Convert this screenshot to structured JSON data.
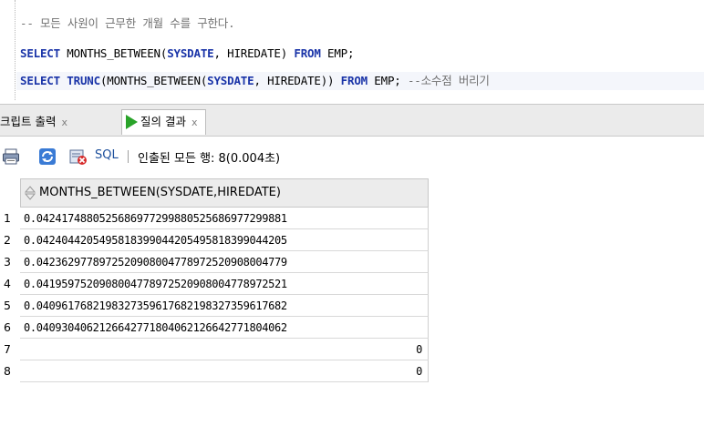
{
  "editor": {
    "lines": [
      {
        "segments": [
          {
            "t": "cm",
            "text": "-- 모든 사원이 근무한 개월 수를 구한다."
          }
        ]
      },
      {
        "segments": [
          {
            "t": "kw",
            "text": "SELECT"
          },
          {
            "t": "tx",
            "text": " MONTHS_BETWEEN("
          },
          {
            "t": "kw",
            "text": "SYSDATE"
          },
          {
            "t": "tx",
            "text": ", HIREDATE) "
          },
          {
            "t": "kw",
            "text": "FROM"
          },
          {
            "t": "tx",
            "text": " EMP;"
          }
        ]
      },
      {
        "segments": [
          {
            "t": "kw",
            "text": "SELECT"
          },
          {
            "t": "tx",
            "text": " "
          },
          {
            "t": "kw",
            "text": "TRUNC"
          },
          {
            "t": "tx",
            "text": "(MONTHS_BETWEEN("
          },
          {
            "t": "kw",
            "text": "SYSDATE"
          },
          {
            "t": "tx",
            "text": ", HIREDATE)) "
          },
          {
            "t": "kw",
            "text": "FROM"
          },
          {
            "t": "tx",
            "text": " EMP; "
          },
          {
            "t": "cm",
            "text": "--소수점 버리기"
          }
        ]
      }
    ]
  },
  "tabs": {
    "script_label": "크립트 출력",
    "result_label": "질의 결과",
    "close_glyph": "x"
  },
  "toolbar": {
    "sql_label": "SQL",
    "status": "인출된 모든 행: 8(0.004초)"
  },
  "grid": {
    "column_header": "MONTHS_BETWEEN(SYSDATE,HIREDATE)",
    "rows": [
      {
        "num": "1",
        "value": "0.0424174880525686977299880525686977299881",
        "align": "left"
      },
      {
        "num": "2",
        "value": "0.0424044205495818399044205495818399044205",
        "align": "left"
      },
      {
        "num": "3",
        "value": "0.0423629778972520908004778972520908004779",
        "align": "left"
      },
      {
        "num": "4",
        "value": "0.0419597520908004778972520908004778972521",
        "align": "left"
      },
      {
        "num": "5",
        "value": "0.0409617682198327359617682198327359617682",
        "align": "left"
      },
      {
        "num": "6",
        "value": "0.0409304062126642771804062126642771804062",
        "align": "left"
      },
      {
        "num": "7",
        "value": "0",
        "align": "right"
      },
      {
        "num": "8",
        "value": "0",
        "align": "right"
      }
    ]
  },
  "colors": {
    "keyword": "#1a34a8",
    "comment": "#707070",
    "run_icon": "#29a329"
  }
}
